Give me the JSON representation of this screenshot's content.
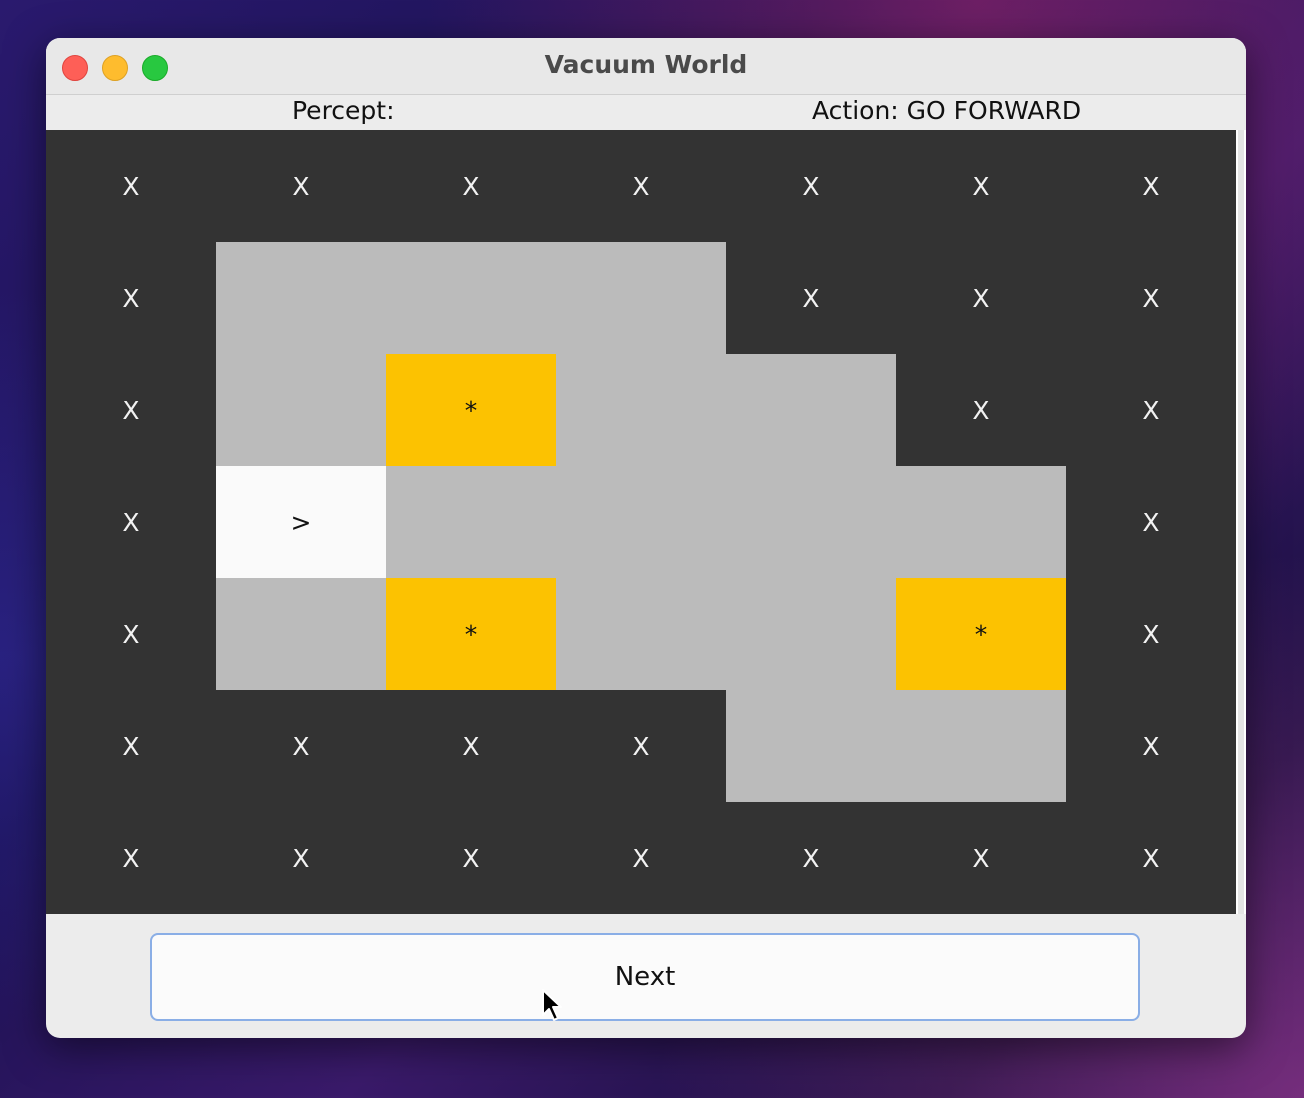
{
  "window": {
    "title": "Vacuum World"
  },
  "status": {
    "percept": "Percept:",
    "action": "Action: GO FORWARD"
  },
  "grid": {
    "rows": 7,
    "cols": 7,
    "cells": [
      [
        "X",
        "X",
        "X",
        "X",
        "X",
        "X",
        "X"
      ],
      [
        "X",
        "",
        "",
        "",
        "X",
        "X",
        "X"
      ],
      [
        "X",
        "",
        "*",
        "",
        "",
        "X",
        "X"
      ],
      [
        "X",
        ">",
        "",
        "",
        "",
        "",
        "X"
      ],
      [
        "X",
        "",
        "*",
        "",
        "",
        "*",
        "X"
      ],
      [
        "X",
        "X",
        "X",
        "X",
        "",
        "",
        "X"
      ],
      [
        "X",
        "X",
        "X",
        "X",
        "X",
        "X",
        "X"
      ]
    ],
    "legend": {
      "X": "wall",
      "": "clean",
      "*": "dirt",
      ">": "agent"
    },
    "colors": {
      "wall": "#333333",
      "clean": "#bbbbbb",
      "dirt": "#fcc201",
      "agent": "#fafafa"
    }
  },
  "controls": {
    "next_label": "Next"
  }
}
